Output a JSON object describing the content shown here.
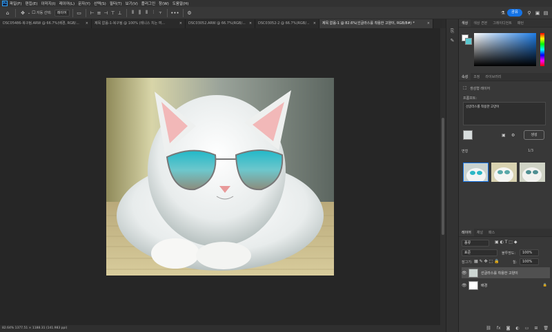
{
  "menu": {
    "app_icon": "Ps",
    "items": [
      "파일(F)",
      "편집(E)",
      "이미지(I)",
      "레이어(L)",
      "문자(Y)",
      "선택(S)",
      "필터(T)",
      "보기(V)",
      "플러그인",
      "창(W)",
      "도움말(H)"
    ]
  },
  "options": {
    "auto_select_label": "자동 선택:",
    "auto_select_value": "레이어",
    "share_label": "공유"
  },
  "tabs": [
    {
      "label": "DSC05486-복구됨.ARW @ 66.7%(배경, RGB/...",
      "close": "×"
    },
    {
      "label": "제목 없음-1-복구됨 @ 100% (테니스 치는 여...",
      "close": "×"
    },
    {
      "label": "DSC03052.ARW @ 66.7%(RGB/...",
      "close": "×"
    },
    {
      "label": "DSC03052-2 @ 66.7%(RGB/...",
      "close": "×"
    },
    {
      "label": "제목 없음-1 @ 82.6%(선글라스를 착용한 고양이, RGB/8#) *",
      "close": "×"
    }
  ],
  "status": "82.64%  1377.51 × 1188.31 (141.983 ppi)",
  "color_panel": {
    "tabs": [
      "색상",
      "색상 견본",
      "그레이디언트",
      "패턴"
    ]
  },
  "properties_panel": {
    "tabs": [
      "속성",
      "조정",
      "라이브러리"
    ],
    "type_label": "생성형 레이어",
    "prompt_label": "프롬프트:",
    "prompt_value": "선글라스를 착용한 고양이",
    "generate_label": "생성",
    "variations_label": "변형",
    "variations_count": "1/3"
  },
  "layers_panel": {
    "tabs": [
      "레이어",
      "채널",
      "패스"
    ],
    "filter_label": "종류",
    "blend_mode": "표준",
    "opacity_label": "불투명도:",
    "opacity_value": "100%",
    "lock_label": "잠그기:",
    "fill_label": "칠:",
    "fill_value": "100%",
    "layers": [
      {
        "name": "선글라스를 착용한 고양이",
        "visible_icon": "eye-icon",
        "selected": true
      },
      {
        "name": "배경",
        "visible_icon": "eye-icon",
        "selected": false
      }
    ]
  },
  "colors": {
    "accent": "#1473e6",
    "panel_bg": "#383838",
    "canvas_bg": "#262626",
    "lens": "#2ab7c6"
  }
}
